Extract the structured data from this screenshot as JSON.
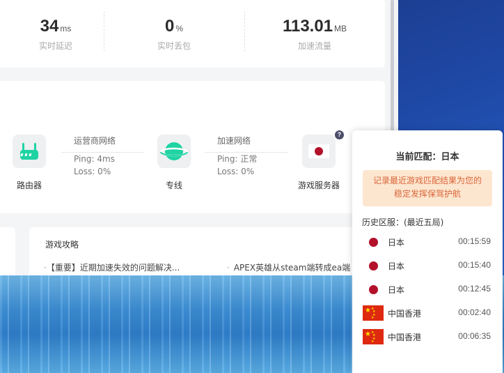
{
  "stats": [
    {
      "value": "34",
      "unit": "ms",
      "label": "实时延迟"
    },
    {
      "value": "0",
      "unit": "%",
      "label": "实时丢包"
    },
    {
      "value": "113.01",
      "unit": "MB",
      "label": "加速流量"
    }
  ],
  "path": {
    "router_label": "路由器",
    "line_label": "专线",
    "server_label": "游戏服务器",
    "help_glyph": "?",
    "isp_network": {
      "title": "运营商网络",
      "ping": "Ping: 4ms",
      "loss": "Loss: 0%"
    },
    "acc_network": {
      "title": "加速网络",
      "ping": "Ping: 正常",
      "loss": "Loss: 0%"
    }
  },
  "guide": {
    "title": "游戏攻略",
    "items": [
      "【重要】近期加速失效的问题解决...",
      "APEX英雄从steam端转成ea端"
    ],
    "bullet": "·"
  },
  "popup": {
    "title": "当前匹配：日本",
    "notice_line1": "记录最近游戏匹配结果为您的",
    "notice_line2": "稳定发挥保驾护航",
    "history_title": "历史区服：(最近五局)",
    "history": [
      {
        "flag": "jp",
        "region": "日本",
        "time": "00:15:59"
      },
      {
        "flag": "jp",
        "region": "日本",
        "time": "00:15:40"
      },
      {
        "flag": "jp",
        "region": "日本",
        "time": "00:12:45"
      },
      {
        "flag": "cn",
        "region": "中国香港",
        "time": "00:02:40"
      },
      {
        "flag": "cn",
        "region": "中国香港",
        "time": "00:06:35"
      }
    ]
  },
  "colors": {
    "accent": "#1fd3a3",
    "notice_bg": "#fde6cf",
    "notice_text": "#d9663a",
    "japan_red": "#b3102a",
    "china_red": "#de2910"
  }
}
